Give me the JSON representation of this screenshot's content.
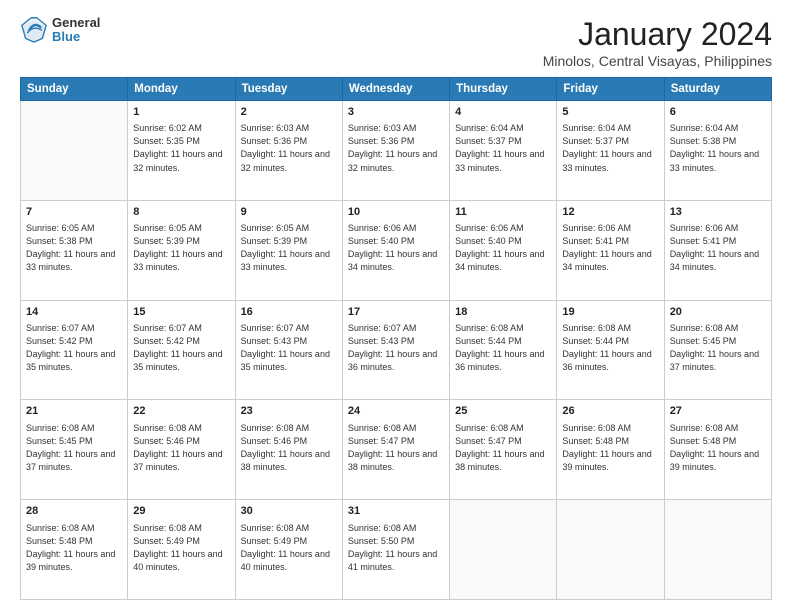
{
  "header": {
    "logo_general": "General",
    "logo_blue": "Blue",
    "month_title": "January 2024",
    "location": "Minolos, Central Visayas, Philippines"
  },
  "weekdays": [
    "Sunday",
    "Monday",
    "Tuesday",
    "Wednesday",
    "Thursday",
    "Friday",
    "Saturday"
  ],
  "weeks": [
    [
      {
        "day": "",
        "sunrise": "",
        "sunset": "",
        "daylight": ""
      },
      {
        "day": "1",
        "sunrise": "Sunrise: 6:02 AM",
        "sunset": "Sunset: 5:35 PM",
        "daylight": "Daylight: 11 hours and 32 minutes."
      },
      {
        "day": "2",
        "sunrise": "Sunrise: 6:03 AM",
        "sunset": "Sunset: 5:36 PM",
        "daylight": "Daylight: 11 hours and 32 minutes."
      },
      {
        "day": "3",
        "sunrise": "Sunrise: 6:03 AM",
        "sunset": "Sunset: 5:36 PM",
        "daylight": "Daylight: 11 hours and 32 minutes."
      },
      {
        "day": "4",
        "sunrise": "Sunrise: 6:04 AM",
        "sunset": "Sunset: 5:37 PM",
        "daylight": "Daylight: 11 hours and 33 minutes."
      },
      {
        "day": "5",
        "sunrise": "Sunrise: 6:04 AM",
        "sunset": "Sunset: 5:37 PM",
        "daylight": "Daylight: 11 hours and 33 minutes."
      },
      {
        "day": "6",
        "sunrise": "Sunrise: 6:04 AM",
        "sunset": "Sunset: 5:38 PM",
        "daylight": "Daylight: 11 hours and 33 minutes."
      }
    ],
    [
      {
        "day": "7",
        "sunrise": "Sunrise: 6:05 AM",
        "sunset": "Sunset: 5:38 PM",
        "daylight": "Daylight: 11 hours and 33 minutes."
      },
      {
        "day": "8",
        "sunrise": "Sunrise: 6:05 AM",
        "sunset": "Sunset: 5:39 PM",
        "daylight": "Daylight: 11 hours and 33 minutes."
      },
      {
        "day": "9",
        "sunrise": "Sunrise: 6:05 AM",
        "sunset": "Sunset: 5:39 PM",
        "daylight": "Daylight: 11 hours and 33 minutes."
      },
      {
        "day": "10",
        "sunrise": "Sunrise: 6:06 AM",
        "sunset": "Sunset: 5:40 PM",
        "daylight": "Daylight: 11 hours and 34 minutes."
      },
      {
        "day": "11",
        "sunrise": "Sunrise: 6:06 AM",
        "sunset": "Sunset: 5:40 PM",
        "daylight": "Daylight: 11 hours and 34 minutes."
      },
      {
        "day": "12",
        "sunrise": "Sunrise: 6:06 AM",
        "sunset": "Sunset: 5:41 PM",
        "daylight": "Daylight: 11 hours and 34 minutes."
      },
      {
        "day": "13",
        "sunrise": "Sunrise: 6:06 AM",
        "sunset": "Sunset: 5:41 PM",
        "daylight": "Daylight: 11 hours and 34 minutes."
      }
    ],
    [
      {
        "day": "14",
        "sunrise": "Sunrise: 6:07 AM",
        "sunset": "Sunset: 5:42 PM",
        "daylight": "Daylight: 11 hours and 35 minutes."
      },
      {
        "day": "15",
        "sunrise": "Sunrise: 6:07 AM",
        "sunset": "Sunset: 5:42 PM",
        "daylight": "Daylight: 11 hours and 35 minutes."
      },
      {
        "day": "16",
        "sunrise": "Sunrise: 6:07 AM",
        "sunset": "Sunset: 5:43 PM",
        "daylight": "Daylight: 11 hours and 35 minutes."
      },
      {
        "day": "17",
        "sunrise": "Sunrise: 6:07 AM",
        "sunset": "Sunset: 5:43 PM",
        "daylight": "Daylight: 11 hours and 36 minutes."
      },
      {
        "day": "18",
        "sunrise": "Sunrise: 6:08 AM",
        "sunset": "Sunset: 5:44 PM",
        "daylight": "Daylight: 11 hours and 36 minutes."
      },
      {
        "day": "19",
        "sunrise": "Sunrise: 6:08 AM",
        "sunset": "Sunset: 5:44 PM",
        "daylight": "Daylight: 11 hours and 36 minutes."
      },
      {
        "day": "20",
        "sunrise": "Sunrise: 6:08 AM",
        "sunset": "Sunset: 5:45 PM",
        "daylight": "Daylight: 11 hours and 37 minutes."
      }
    ],
    [
      {
        "day": "21",
        "sunrise": "Sunrise: 6:08 AM",
        "sunset": "Sunset: 5:45 PM",
        "daylight": "Daylight: 11 hours and 37 minutes."
      },
      {
        "day": "22",
        "sunrise": "Sunrise: 6:08 AM",
        "sunset": "Sunset: 5:46 PM",
        "daylight": "Daylight: 11 hours and 37 minutes."
      },
      {
        "day": "23",
        "sunrise": "Sunrise: 6:08 AM",
        "sunset": "Sunset: 5:46 PM",
        "daylight": "Daylight: 11 hours and 38 minutes."
      },
      {
        "day": "24",
        "sunrise": "Sunrise: 6:08 AM",
        "sunset": "Sunset: 5:47 PM",
        "daylight": "Daylight: 11 hours and 38 minutes."
      },
      {
        "day": "25",
        "sunrise": "Sunrise: 6:08 AM",
        "sunset": "Sunset: 5:47 PM",
        "daylight": "Daylight: 11 hours and 38 minutes."
      },
      {
        "day": "26",
        "sunrise": "Sunrise: 6:08 AM",
        "sunset": "Sunset: 5:48 PM",
        "daylight": "Daylight: 11 hours and 39 minutes."
      },
      {
        "day": "27",
        "sunrise": "Sunrise: 6:08 AM",
        "sunset": "Sunset: 5:48 PM",
        "daylight": "Daylight: 11 hours and 39 minutes."
      }
    ],
    [
      {
        "day": "28",
        "sunrise": "Sunrise: 6:08 AM",
        "sunset": "Sunset: 5:48 PM",
        "daylight": "Daylight: 11 hours and 39 minutes."
      },
      {
        "day": "29",
        "sunrise": "Sunrise: 6:08 AM",
        "sunset": "Sunset: 5:49 PM",
        "daylight": "Daylight: 11 hours and 40 minutes."
      },
      {
        "day": "30",
        "sunrise": "Sunrise: 6:08 AM",
        "sunset": "Sunset: 5:49 PM",
        "daylight": "Daylight: 11 hours and 40 minutes."
      },
      {
        "day": "31",
        "sunrise": "Sunrise: 6:08 AM",
        "sunset": "Sunset: 5:50 PM",
        "daylight": "Daylight: 11 hours and 41 minutes."
      },
      {
        "day": "",
        "sunrise": "",
        "sunset": "",
        "daylight": ""
      },
      {
        "day": "",
        "sunrise": "",
        "sunset": "",
        "daylight": ""
      },
      {
        "day": "",
        "sunrise": "",
        "sunset": "",
        "daylight": ""
      }
    ]
  ]
}
